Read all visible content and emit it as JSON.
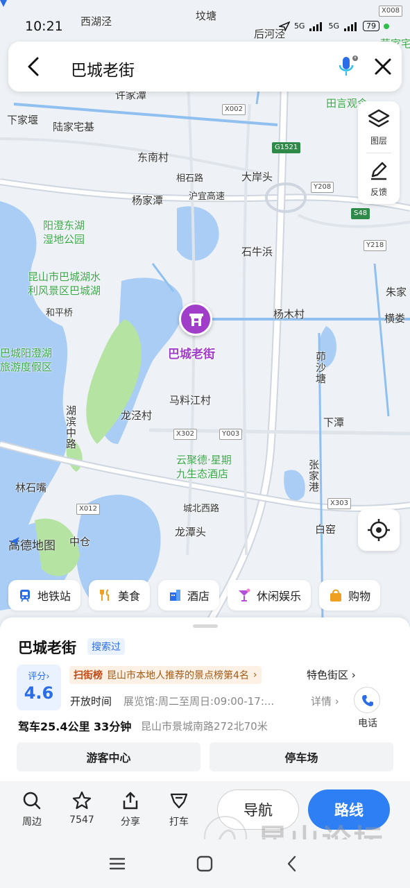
{
  "status_bar": {
    "time": "10:21",
    "net1": "5G",
    "net2": "5G",
    "battery": "79"
  },
  "search": {
    "query": "巴城老街"
  },
  "tools": {
    "layers_label": "图层",
    "feedback_label": "反馈"
  },
  "map": {
    "poi_label": "巴城老街",
    "logo": "高德地图",
    "place_labels": [
      "西湖泾",
      "坟塘",
      "后河泾",
      "许家潭",
      "下家堰",
      "陆家宅基",
      "田言观令",
      "东南村",
      "相石路",
      "大岸头",
      "杨家潭",
      "沪宜高速",
      "阳澄东湖",
      "湿地公园",
      "石牛浜",
      "昆山市巴城湖水",
      "利风景区巴城湖",
      "和平桥",
      "朱家",
      "杨木村",
      "横娄",
      "巴城阳澄湖",
      "旅游度假区",
      "马料江村",
      "龙泾村",
      "下潭",
      "云聚德·星期",
      "九生态酒店",
      "林石嘴",
      "城北西路",
      "龙潭头",
      "白窑",
      "中仓",
      "荣家宅"
    ],
    "vertical_labels": [
      "湖滨中路",
      "茆沙塘",
      "张家港"
    ],
    "road_codes": [
      "X002",
      "G1521",
      "Y208",
      "S48",
      "Y218",
      "X302",
      "Y003",
      "X303",
      "X012",
      "X008"
    ]
  },
  "categories": [
    {
      "label": "地铁站",
      "icon": "subway-icon",
      "color": "#2b6de6"
    },
    {
      "label": "美食",
      "icon": "food-icon",
      "color": "#f0a020"
    },
    {
      "label": "酒店",
      "icon": "hotel-icon",
      "color": "#2b6de6"
    },
    {
      "label": "休闲娱乐",
      "icon": "leisure-icon",
      "color": "#b44fd9"
    },
    {
      "label": "购物",
      "icon": "shopping-icon",
      "color": "#f0a020"
    }
  ],
  "poi": {
    "title": "巴城老街",
    "searched_badge": "搜索过",
    "score_label": "评分",
    "score": "4.6",
    "rank_tag": "扫街榜",
    "rank_text": "昆山市本地人推荐的景点榜第4名",
    "feature": "特色街区",
    "hours_label": "开放时间",
    "hours_value": "展览馆:周二至周日:09:00-17:...",
    "detail": "详情",
    "phone_label": "电话",
    "drive": "驾车25.4公里 33分钟",
    "address": "昆山市景城南路272北70米",
    "btn_visitor": "游客中心",
    "btn_parking": "停车场"
  },
  "actions": {
    "nearby": "周边",
    "favorite_count": "7547",
    "share": "分享",
    "taxi": "打车",
    "navigate": "导航",
    "route": "路线"
  },
  "watermark": {
    "text": "昆山论坛"
  },
  "colors": {
    "accent": "#2e7ff3",
    "poi_purple": "#a03ec9",
    "water": "#a9cdf5",
    "green_area": "#b5e3a2"
  }
}
